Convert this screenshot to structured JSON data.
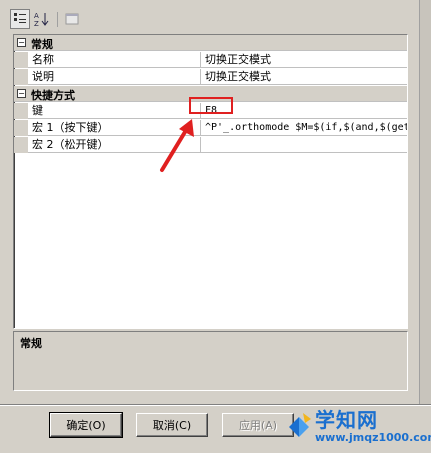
{
  "toolbar": {
    "buttons": [
      {
        "icon": "categorized-icon",
        "active": true
      },
      {
        "icon": "sort-az-icon",
        "active": false
      },
      {
        "icon": "property-pages-icon",
        "active": false
      }
    ]
  },
  "grid": {
    "category_general": "常规",
    "prop_name_label": "名称",
    "prop_name_value": "切换正交模式",
    "prop_desc_label": "说明",
    "prop_desc_value": "切换正交模式",
    "category_shortcut": "快捷方式",
    "prop_key_label": "键",
    "prop_key_value": "F8",
    "prop_macro1_label": "宏 1（按下键）",
    "prop_macro1_value": "^P'_.orthomode $M=$(if,$(and,$(getv",
    "prop_macro2_label": "宏 2（松开键）",
    "prop_macro2_value": ""
  },
  "description": {
    "title": "常规"
  },
  "buttons": {
    "ok": "确定(O)",
    "cancel": "取消(C)",
    "apply": "应用(A)"
  },
  "watermark": {
    "text": "学知网",
    "url": "www.jmqz1000.com"
  },
  "colors": {
    "highlight": "#e02020",
    "watermark": "#1a6fcf"
  }
}
